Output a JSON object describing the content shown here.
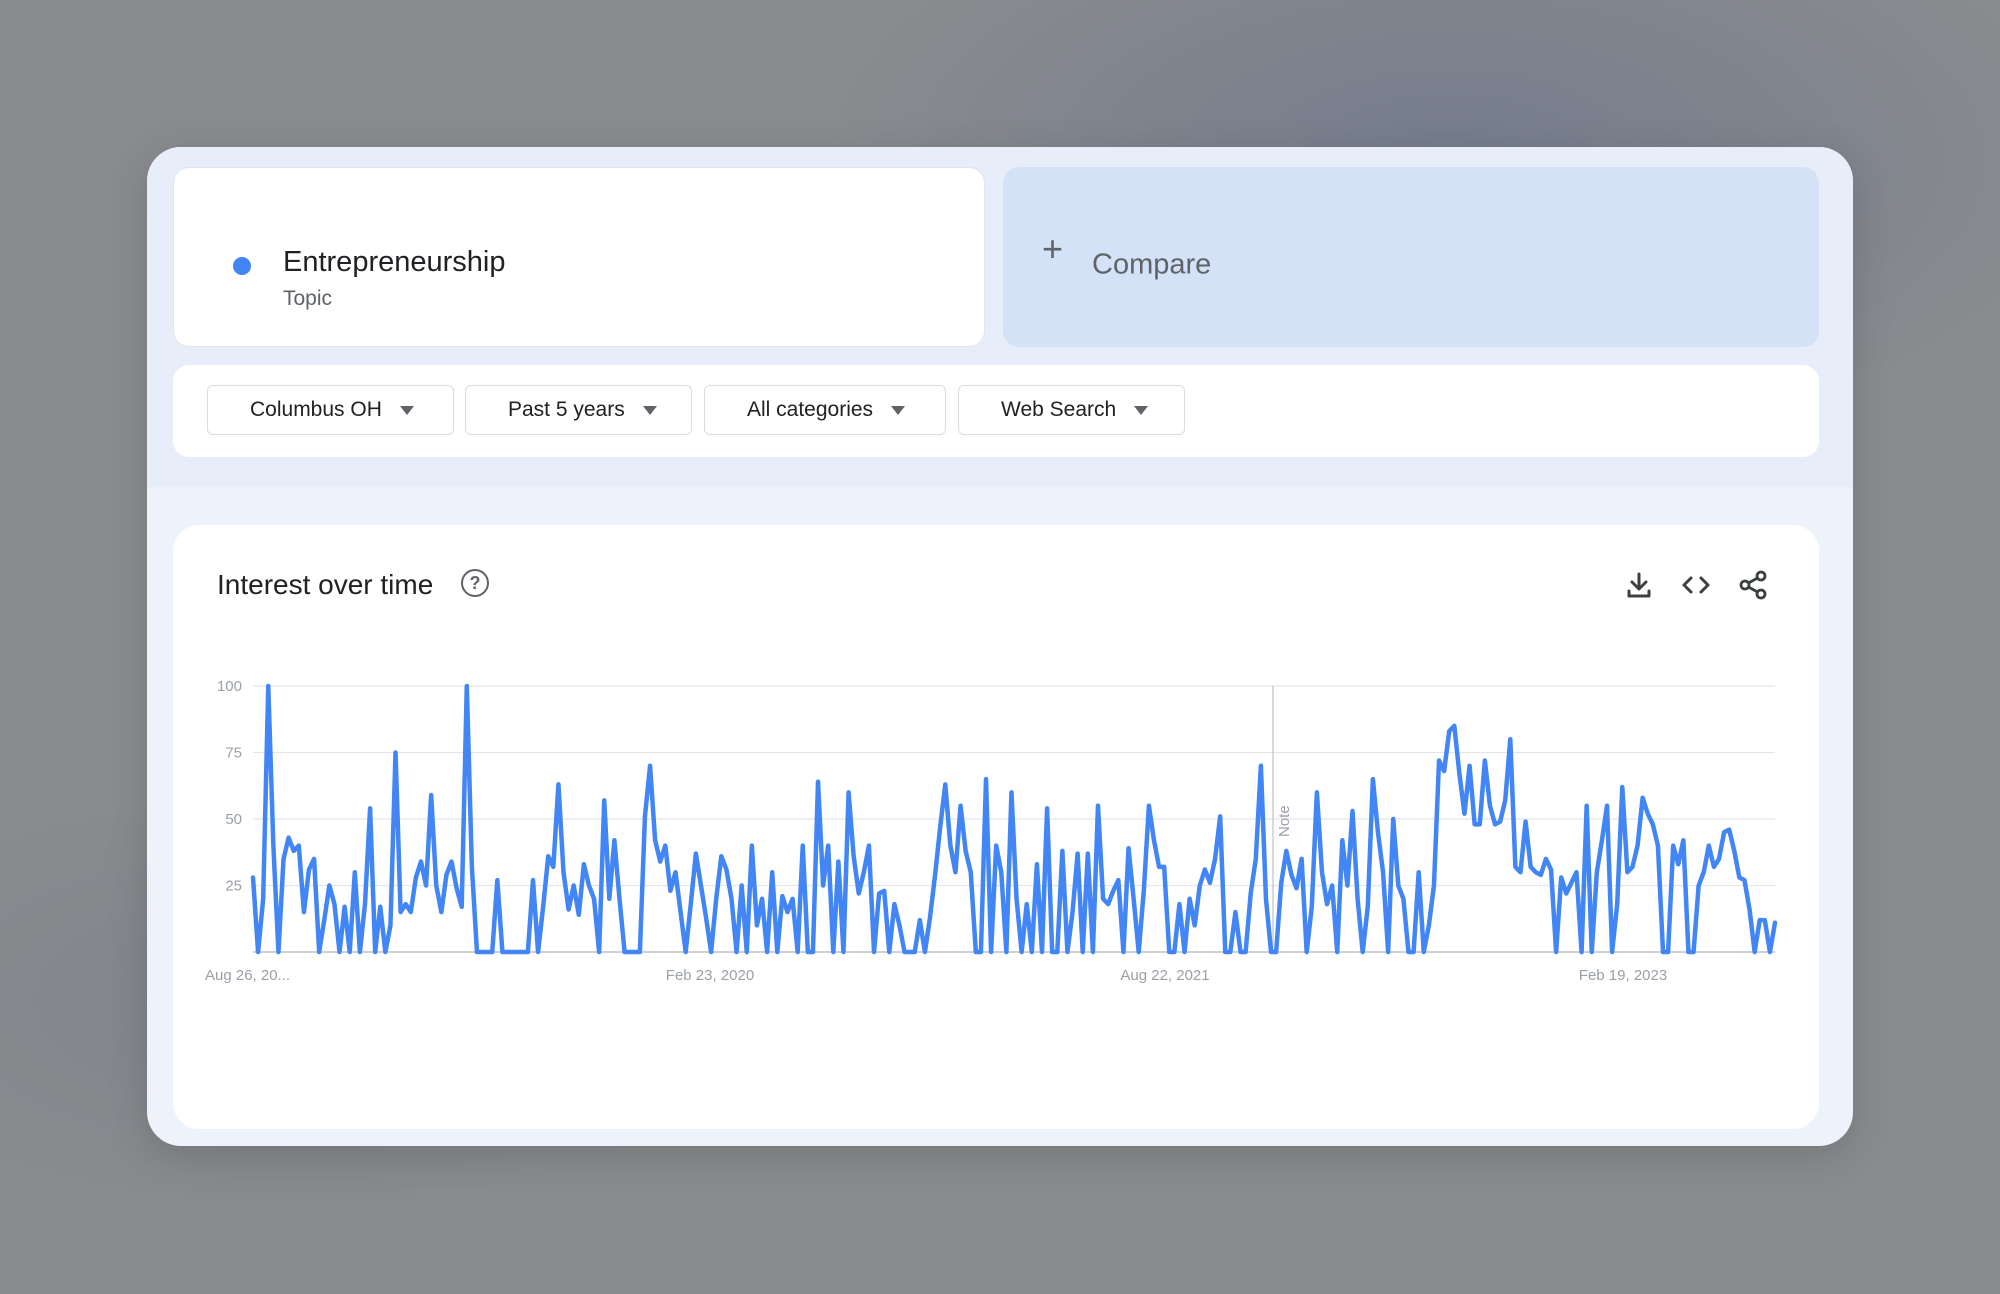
{
  "search_term": {
    "name": "Entrepreneurship",
    "type": "Topic",
    "color": "#4285f4"
  },
  "compare": {
    "icon": "plus-icon",
    "label": "Compare"
  },
  "filters": [
    {
      "label": "Columbus OH",
      "icon": "dropdown-arrow-icon"
    },
    {
      "label": "Past 5 years",
      "icon": "dropdown-arrow-icon"
    },
    {
      "label": "All categories",
      "icon": "dropdown-arrow-icon"
    },
    {
      "label": "Web Search",
      "icon": "dropdown-arrow-icon"
    }
  ],
  "interest_panel": {
    "title": "Interest over time",
    "help_icon": "help-circle-icon",
    "tools": [
      "download-icon",
      "embed-code-icon",
      "share-icon"
    ]
  },
  "chart_data": {
    "type": "line",
    "x_tick_labels": [
      "Aug 26, 20...",
      "Feb 23, 2020",
      "Aug 22, 2021",
      "Feb 19, 2023"
    ],
    "y_tick_labels": [
      "100",
      "75",
      "50",
      "25"
    ],
    "ylim": [
      0,
      100
    ],
    "annotation": "Note",
    "grid": true,
    "series": [
      {
        "color": "#4285f4",
        "values": [
          28,
          0,
          20,
          100,
          40,
          0,
          35,
          43,
          38,
          40,
          15,
          31,
          35,
          0,
          12,
          25,
          18,
          0,
          17,
          0,
          30,
          0,
          18,
          54,
          0,
          17,
          0,
          10,
          75,
          15,
          18,
          15,
          28,
          34,
          25,
          59,
          25,
          15,
          29,
          34,
          24,
          17,
          100,
          32,
          0,
          0,
          0,
          0,
          27,
          0,
          0,
          0,
          0,
          0,
          0,
          27,
          0,
          17,
          36,
          32,
          63,
          30,
          16,
          25,
          14,
          33,
          25,
          20,
          0,
          57,
          20,
          42,
          20,
          0,
          0,
          0,
          0,
          51,
          70,
          42,
          34,
          40,
          23,
          30,
          15,
          0,
          18,
          37,
          25,
          13,
          0,
          20,
          36,
          31,
          20,
          0,
          25,
          0,
          40,
          10,
          20,
          0,
          30,
          0,
          21,
          15,
          20,
          0,
          40,
          0,
          0,
          64,
          25,
          40,
          0,
          34,
          0,
          60,
          36,
          22,
          30,
          40,
          0,
          22,
          23,
          0,
          18,
          10,
          0,
          0,
          0,
          12,
          0,
          13,
          29,
          47,
          63,
          40,
          30,
          55,
          38,
          30,
          0,
          0,
          65,
          0,
          40,
          30,
          0,
          60,
          20,
          0,
          18,
          0,
          33,
          0,
          54,
          0,
          0,
          38,
          0,
          15,
          37,
          0,
          37,
          0,
          55,
          20,
          18,
          23,
          27,
          0,
          39,
          20,
          0,
          23,
          55,
          42,
          32,
          32,
          0,
          0,
          18,
          0,
          20,
          10,
          25,
          31,
          26,
          35,
          51,
          0,
          0,
          15,
          0,
          0,
          22,
          35,
          70,
          20,
          0,
          0,
          26,
          38,
          29,
          24,
          35,
          0,
          17,
          60,
          30,
          18,
          25,
          0,
          42,
          25,
          53,
          20,
          0,
          17,
          65,
          45,
          30,
          0,
          50,
          25,
          20,
          0,
          0,
          30,
          0,
          10,
          25,
          72,
          68,
          83,
          85,
          67,
          52,
          70,
          48,
          48,
          72,
          55,
          48,
          49,
          57,
          80,
          32,
          30,
          49,
          32,
          30,
          29,
          35,
          31,
          0,
          28,
          22,
          26,
          30,
          0,
          55,
          0,
          30,
          42,
          55,
          0,
          18,
          62,
          30,
          32,
          40,
          58,
          52,
          48,
          40,
          0,
          0,
          40,
          33,
          42,
          0,
          0,
          25,
          30,
          40,
          32,
          35,
          45,
          46,
          38,
          28,
          27,
          16,
          0,
          12,
          12,
          0,
          11
        ]
      }
    ]
  }
}
